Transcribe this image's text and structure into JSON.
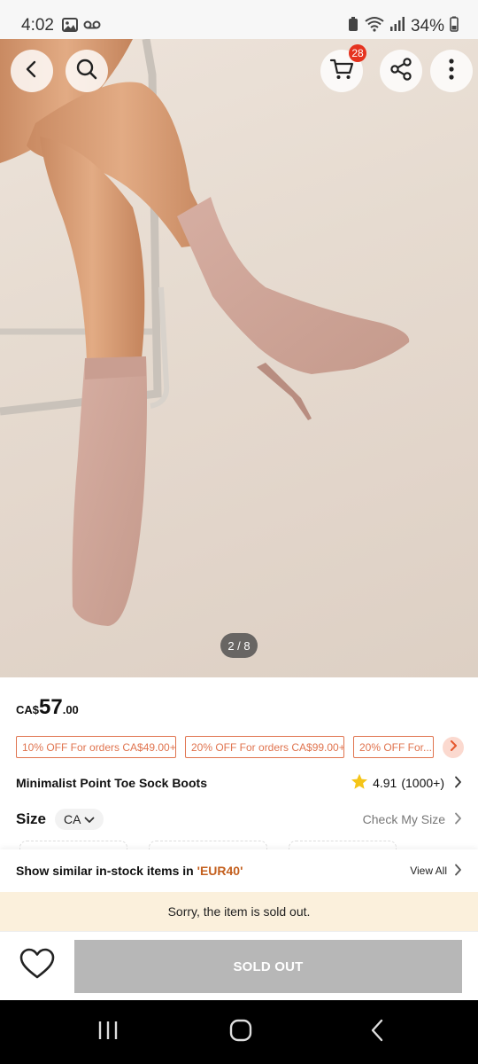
{
  "status_bar": {
    "time": "4:02",
    "battery": "34%",
    "icons_left": [
      "image-icon",
      "voicemail-icon"
    ],
    "icons_right": [
      "battery-saver-icon",
      "wifi-icon",
      "signal-icon",
      "battery-icon"
    ]
  },
  "header": {
    "cart_count": "28",
    "buttons": [
      "back-icon",
      "search-icon",
      "cart-icon",
      "share-icon",
      "more-icon"
    ]
  },
  "gallery": {
    "counter": "2 / 8",
    "current_image": 2,
    "total_images": 8
  },
  "product": {
    "currency": "CA$",
    "price_whole": "57",
    "price_cents": ".00",
    "name": "Minimalist Point Toe Sock Boots",
    "rating": "4.91",
    "rating_count": "(1000+)",
    "coupons": [
      "10% OFF For orders CA$49.00+",
      "20% OFF For orders CA$99.00+",
      "20% OFF For..."
    ]
  },
  "size": {
    "label": "Size",
    "region": "CA",
    "check_label": "Check My Size"
  },
  "similar": {
    "text_prefix": "Show similar in-stock items in ",
    "size_highlight": "'EUR40'",
    "view_all": "View All"
  },
  "notice": {
    "sold_out_message": "Sorry, the item is sold out."
  },
  "actions": {
    "sold_out_label": "SOLD OUT"
  },
  "colors": {
    "accent_orange": "#e0744f",
    "badge_red": "#e5331f",
    "sold_out_gray": "#b7b7b7",
    "notice_bg": "#fbf0dc",
    "star_yellow": "#f5c518"
  }
}
